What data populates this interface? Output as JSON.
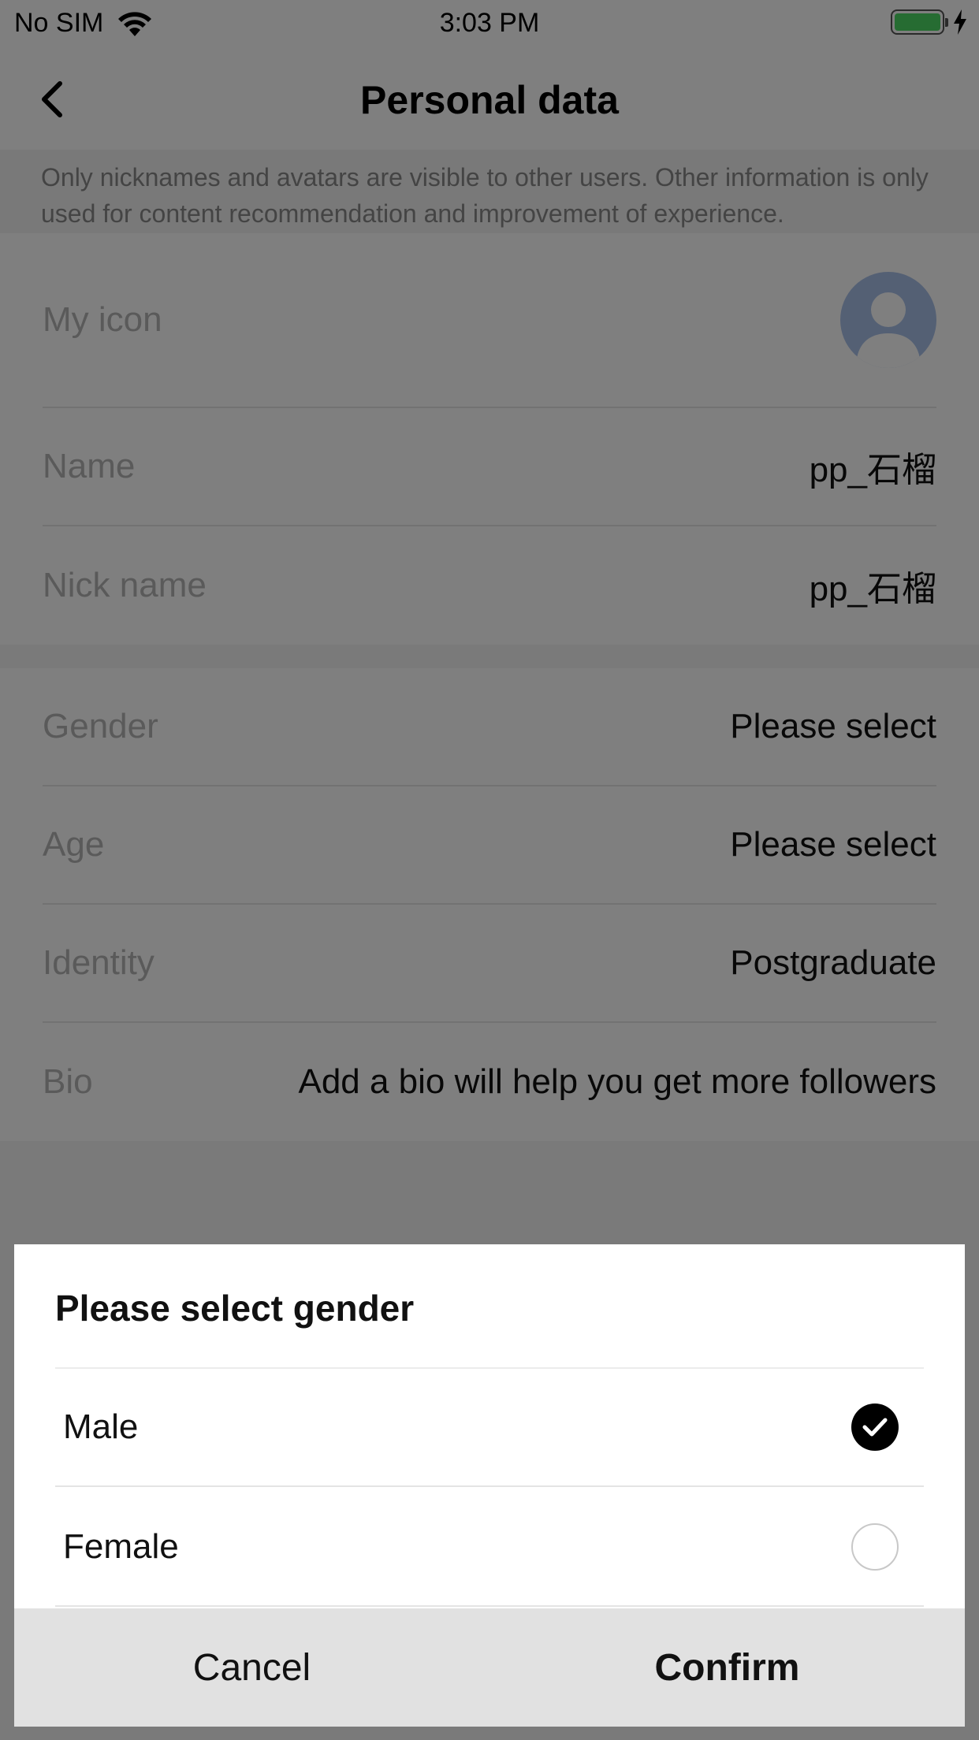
{
  "status_bar": {
    "carrier": "No SIM",
    "time": "3:03 PM",
    "battery_color": "#4cd964"
  },
  "nav": {
    "title": "Personal data",
    "back_icon": "chevron-left-icon"
  },
  "info_note": "Only nicknames and avatars are visible to other users. Other information is only used for content recommendation and improvement of experience.",
  "profile": {
    "icon_label": "My icon",
    "name_label": "Name",
    "name_value": "pp_石榴",
    "nickname_label": "Nick name",
    "nickname_value": "pp_石榴"
  },
  "details": {
    "gender_label": "Gender",
    "gender_value": "Please select",
    "age_label": "Age",
    "age_value": "Please select",
    "identity_label": "Identity",
    "identity_value": "Postgraduate",
    "bio_label": "Bio",
    "bio_value": "Add a bio will help you get more followers"
  },
  "dialog": {
    "title": "Please select gender",
    "options": [
      {
        "label": "Male",
        "selected": true
      },
      {
        "label": "Female",
        "selected": false
      }
    ],
    "cancel_label": "Cancel",
    "confirm_label": "Confirm"
  }
}
